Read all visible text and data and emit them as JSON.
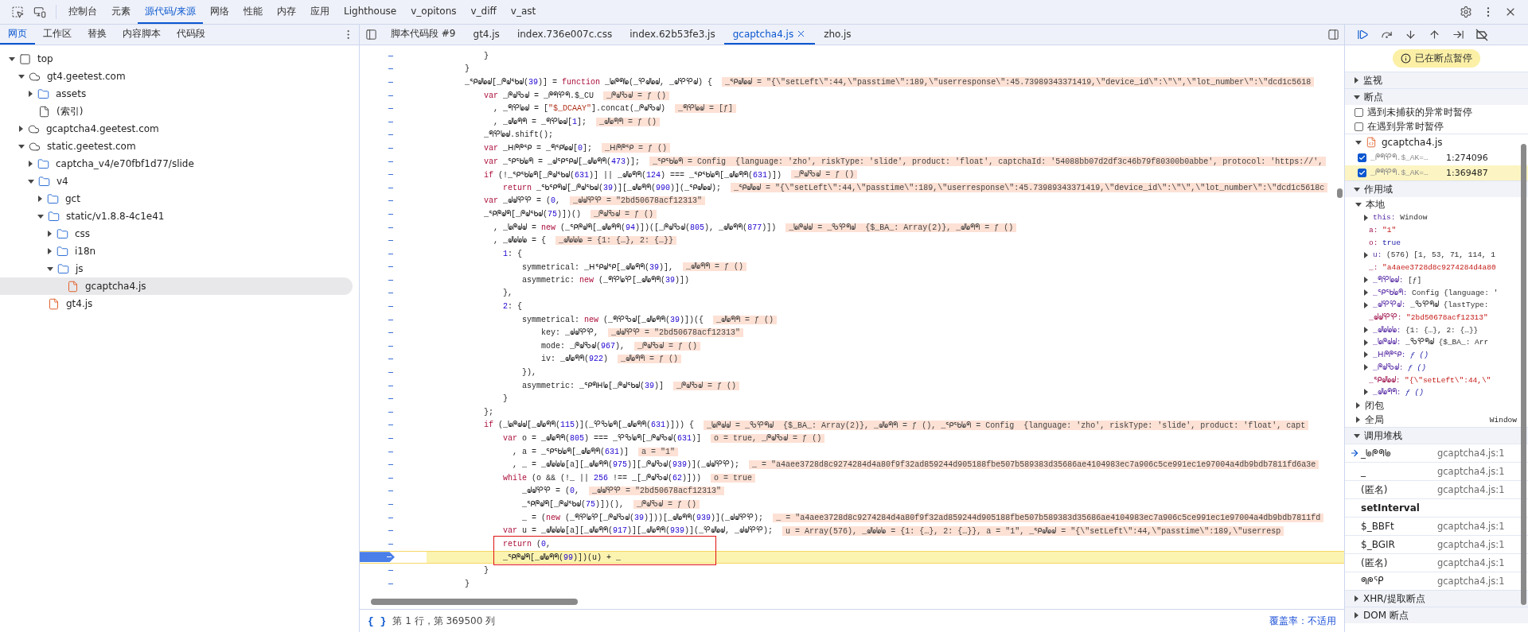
{
  "top_tabs": [
    {
      "label": "控制台",
      "selected": false
    },
    {
      "label": "元素",
      "selected": false
    },
    {
      "label": "源代码/来源",
      "selected": true
    },
    {
      "label": "网络",
      "selected": false
    },
    {
      "label": "性能",
      "selected": false
    },
    {
      "label": "内存",
      "selected": false
    },
    {
      "label": "应用",
      "selected": false
    },
    {
      "label": "Lighthouse",
      "selected": false
    },
    {
      "label": "v_opitons",
      "selected": false
    },
    {
      "label": "v_diff",
      "selected": false
    },
    {
      "label": "v_ast",
      "selected": false
    }
  ],
  "sidebar": {
    "tabs": [
      {
        "label": "网页",
        "selected": true
      },
      {
        "label": "工作区",
        "selected": false
      },
      {
        "label": "替换",
        "selected": false
      },
      {
        "label": "内容脚本",
        "selected": false
      },
      {
        "label": "代码段",
        "selected": false
      }
    ],
    "tree": [
      {
        "label": "top",
        "kind": "frame",
        "selected": false,
        "expanded": true,
        "children": [
          {
            "label": "gt4.geetest.com",
            "kind": "domain",
            "selected": false,
            "expanded": true,
            "children": [
              {
                "label": "assets",
                "kind": "folder",
                "selected": false,
                "expanded": false
              },
              {
                "label": "(索引)",
                "kind": "file",
                "selected": false
              }
            ]
          },
          {
            "label": "gcaptcha4.geetest.com",
            "kind": "domain",
            "selected": false,
            "expanded": false
          },
          {
            "label": "static.geetest.com",
            "kind": "domain",
            "selected": false,
            "expanded": true,
            "children": [
              {
                "label": "captcha_v4/e70fbf1d77/slide",
                "kind": "folder",
                "selected": false,
                "expanded": false
              },
              {
                "label": "v4",
                "kind": "folder",
                "selected": false,
                "expanded": true,
                "children": [
                  {
                    "label": "gct",
                    "kind": "folder",
                    "selected": false,
                    "expanded": false
                  },
                  {
                    "label": "static/v1.8.8-4c1e41",
                    "kind": "folder",
                    "selected": false,
                    "expanded": true,
                    "children": [
                      {
                        "label": "css",
                        "kind": "folder",
                        "selected": false,
                        "expanded": false
                      },
                      {
                        "label": "i18n",
                        "kind": "folder",
                        "selected": false,
                        "expanded": false
                      },
                      {
                        "label": "js",
                        "kind": "folder",
                        "selected": false,
                        "expanded": true,
                        "children": [
                          {
                            "label": "gcaptcha4.js",
                            "kind": "script",
                            "selected": true
                          }
                        ]
                      }
                    ]
                  },
                  {
                    "label": "gt4.js",
                    "kind": "script",
                    "selected": false
                  }
                ]
              }
            ]
          }
        ]
      }
    ]
  },
  "editor": {
    "tabs": [
      {
        "label": "脚本代码段 #9",
        "selected": false,
        "closable": false
      },
      {
        "label": "gt4.js",
        "selected": false,
        "closable": false
      },
      {
        "label": "index.736e007c.css",
        "selected": false,
        "closable": false
      },
      {
        "label": "index.62b53fe3.js",
        "selected": false,
        "closable": false
      },
      {
        "label": "gcaptcha4.js",
        "selected": true,
        "closable": true
      },
      {
        "label": "zho.js",
        "selected": false,
        "closable": false
      }
    ],
    "code_lines": [
      {
        "code": [
          {
            "kind": "plain",
            "text": "            }"
          }
        ],
        "paused": false,
        "boxed": false
      },
      {
        "code": [
          {
            "kind": "plain",
            "text": "        }"
          }
        ],
        "paused": false,
        "boxed": false
      },
      {
        "code": [
          {
            "kind": "plain",
            "text": "        _ᕿᖙᖚᖙ[_ᖘᖙᖃᖙ("
          },
          {
            "kind": "number",
            "text": "39"
          },
          {
            "kind": "plain",
            "text": ")] = "
          },
          {
            "kind": "keyword",
            "text": "function"
          },
          {
            "kind": "plain",
            "text": " _ᖚᖘᖗᖚ(_ᕿᖙᖚᖙ, _ᖙᕿᕿᖙ) {"
          }
        ],
        "value": "_ᕿᖙᖚᖙ = \"{\\\"setLeft\\\":44,\\\"passtime\\\":189,\\\"userresponse\\\":45.73989343371419,\\\"device_id\\\":\\\"\\\",\\\"lot_number\\\":\\\"dcd1c5618",
        "paused": false,
        "boxed": false
      },
      {
        "code": [
          {
            "kind": "keyword",
            "text": "            var"
          },
          {
            "kind": "plain",
            "text": " _ᖘᖙᖃᖙ = _ᖘᖗᕿᖗ.$_CU"
          }
        ],
        "value": "_ᖘᖙᖃᖙ = ƒ ()",
        "paused": false,
        "boxed": false
      },
      {
        "code": [
          {
            "kind": "plain",
            "text": "              , _ᖗᕿᖚᖙ = ["
          },
          {
            "kind": "string",
            "text": "\"$_DCAAY\""
          },
          {
            "kind": "plain",
            "text": "].concat(_ᖘᖙᖃᖙ)"
          }
        ],
        "value": "_ᖗᕿᖚᖙ = [ƒ]",
        "paused": false,
        "boxed": false
      },
      {
        "code": [
          {
            "kind": "plain",
            "text": "              , _ᖙᖚᖗᖗ = _ᖗᕿᖚᖙ["
          },
          {
            "kind": "number",
            "text": "1"
          },
          {
            "kind": "plain",
            "text": "];"
          }
        ],
        "value": "_ᖙᖚᖗᖗ = ƒ ()",
        "paused": false,
        "boxed": false
      },
      {
        "code": [
          {
            "kind": "plain",
            "text": "            _ᖗᕿᖚᖙ.shift();"
          }
        ],
        "paused": false,
        "boxed": false
      },
      {
        "code": [
          {
            "kind": "keyword",
            "text": "            var"
          },
          {
            "kind": "plain",
            "text": " _ᕼᖘᖘᕿ = _ᖗᕿᖚᖙ["
          },
          {
            "kind": "number",
            "text": "0"
          },
          {
            "kind": "plain",
            "text": "];"
          }
        ],
        "value": "_ᕼᖘᖘᕿ = ƒ ()",
        "paused": false,
        "boxed": false
      },
      {
        "code": [
          {
            "kind": "keyword",
            "text": "            var"
          },
          {
            "kind": "plain",
            "text": " _ᕿᖃᖚᖗ = _ᖙᕿᕿᖙ[_ᖙᖚᖗᖗ("
          },
          {
            "kind": "number",
            "text": "473"
          },
          {
            "kind": "plain",
            "text": ")];"
          }
        ],
        "value": "_ᕿᖃᖚᖗ = Config  {language: 'zho', riskType: 'slide', product: 'float', captchaId: '54088bb07d2df3c46b79f80300b0abbe', protocol: 'https://',",
        "paused": false,
        "boxed": false
      },
      {
        "code": [
          {
            "kind": "keyword",
            "text": "            if"
          },
          {
            "kind": "plain",
            "text": " (!_ᕿᖃᖚᖗ[_ᖘᖙᖃᖙ("
          },
          {
            "kind": "number",
            "text": "631"
          },
          {
            "kind": "plain",
            "text": ")] || _ᖙᖚᖗᖗ("
          },
          {
            "kind": "number",
            "text": "124"
          },
          {
            "kind": "plain",
            "text": ") === _ᕿᖃᖚᖗ[_ᖙᖚᖗᖗ("
          },
          {
            "kind": "number",
            "text": "631"
          },
          {
            "kind": "plain",
            "text": ")])"
          }
        ],
        "value": "_ᖘᖙᖃᖙ = ƒ ()",
        "paused": false,
        "boxed": false
      },
      {
        "code": [
          {
            "kind": "keyword",
            "text": "                return"
          },
          {
            "kind": "plain",
            "text": " _ᖃᕿᖗᖙ[_ᖘᖙᖃᖙ("
          },
          {
            "kind": "number",
            "text": "39"
          },
          {
            "kind": "plain",
            "text": ")][_ᖙᖚᖗᖗ("
          },
          {
            "kind": "number",
            "text": "990"
          },
          {
            "kind": "plain",
            "text": ")](_ᕿᖙᖚᖙ);"
          }
        ],
        "value": "_ᕿᖙᖚᖙ = \"{\\\"setLeft\\\":44,\\\"passtime\\\":189,\\\"userresponse\\\":45.73989343371419,\\\"device_id\\\":\\\"\\\",\\\"lot_number\\\":\\\"dcd1c5618c",
        "paused": false,
        "boxed": false
      },
      {
        "code": [
          {
            "kind": "keyword",
            "text": "            var"
          },
          {
            "kind": "plain",
            "text": " _ᖙᖙᕿᕿ = ("
          },
          {
            "kind": "number",
            "text": "0"
          },
          {
            "kind": "plain",
            "text": ","
          }
        ],
        "value": "_ᖙᖙᕿᕿ = \"2bd50678acf12313\"",
        "paused": false,
        "boxed": false
      },
      {
        "code": [
          {
            "kind": "plain",
            "text": "            _ᕿᖘᖙᖗ[_ᖘᖙᖃᖙ("
          },
          {
            "kind": "number",
            "text": "75"
          },
          {
            "kind": "plain",
            "text": ")])()"
          }
        ],
        "value": "_ᖘᖙᖃᖙ = ƒ ()",
        "paused": false,
        "boxed": false
      },
      {
        "code": [
          {
            "kind": "plain",
            "text": "              , _ᖚᖘᖙᖙ = "
          },
          {
            "kind": "keyword",
            "text": "new"
          },
          {
            "kind": "plain",
            "text": " (_ᕿᖘᖙᖗ[_ᖙᖚᖗᖗ("
          },
          {
            "kind": "number",
            "text": "94"
          },
          {
            "kind": "plain",
            "text": ")])([_ᖘᖙᖃᖙ("
          },
          {
            "kind": "number",
            "text": "805"
          },
          {
            "kind": "plain",
            "text": "), _ᖙᖚᖗᖗ("
          },
          {
            "kind": "number",
            "text": "877"
          },
          {
            "kind": "plain",
            "text": ")])"
          }
        ],
        "value": "_ᖚᖘᖙᖙ = _ᖃᕿᖗᖙ  {$_BA_: Array(2)}, _ᖙᖚᖗᖗ = ƒ ()",
        "paused": false,
        "boxed": false
      },
      {
        "code": [
          {
            "kind": "plain",
            "text": "              , _ᖙᖚᖚᖚ = {"
          }
        ],
        "value": "_ᖙᖚᖚᖚ = {1: {…}, 2: {…}}",
        "paused": false,
        "boxed": false
      },
      {
        "code": [
          {
            "kind": "number",
            "text": "                1"
          },
          {
            "kind": "plain",
            "text": ": {"
          }
        ],
        "paused": false,
        "boxed": false
      },
      {
        "code": [
          {
            "kind": "plain",
            "text": "                    symmetrical: _ᕼᕿᖙᕿ[_ᖙᖚᖗᖗ("
          },
          {
            "kind": "number",
            "text": "39"
          },
          {
            "kind": "plain",
            "text": ")],"
          }
        ],
        "value": "_ᖙᖚᖗᖗ = ƒ ()",
        "paused": false,
        "boxed": false
      },
      {
        "code": [
          {
            "kind": "plain",
            "text": "                    asymmetric: "
          },
          {
            "kind": "keyword",
            "text": "new"
          },
          {
            "kind": "plain",
            "text": " (_ᖗᕿᖚᕿ[_ᖙᖚᖗᖗ("
          },
          {
            "kind": "number",
            "text": "39"
          },
          {
            "kind": "plain",
            "text": ")])"
          }
        ],
        "paused": false,
        "boxed": false
      },
      {
        "code": [
          {
            "kind": "plain",
            "text": "                },"
          }
        ],
        "paused": false,
        "boxed": false
      },
      {
        "code": [
          {
            "kind": "number",
            "text": "                2"
          },
          {
            "kind": "plain",
            "text": ": {"
          }
        ],
        "paused": false,
        "boxed": false
      },
      {
        "code": [
          {
            "kind": "plain",
            "text": "                    symmetrical: "
          },
          {
            "kind": "keyword",
            "text": "new"
          },
          {
            "kind": "plain",
            "text": " (_ᖗᕿᖃᖙ[_ᖙᖚᖗᖗ("
          },
          {
            "kind": "number",
            "text": "39"
          },
          {
            "kind": "plain",
            "text": ")])({"
          }
        ],
        "value": "_ᖙᖚᖗᖗ = ƒ ()",
        "paused": false,
        "boxed": false
      },
      {
        "code": [
          {
            "kind": "plain",
            "text": "                        key: _ᖙᖙᕿᕿ,"
          }
        ],
        "value": "_ᖙᖙᕿᕿ = \"2bd50678acf12313\"",
        "paused": false,
        "boxed": false
      },
      {
        "code": [
          {
            "kind": "plain",
            "text": "                        mode: _ᖘᖙᖃᖙ("
          },
          {
            "kind": "number",
            "text": "967"
          },
          {
            "kind": "plain",
            "text": "),"
          }
        ],
        "value": "_ᖘᖙᖃᖙ = ƒ ()",
        "paused": false,
        "boxed": false
      },
      {
        "code": [
          {
            "kind": "plain",
            "text": "                        iv: _ᖙᖚᖗᖗ("
          },
          {
            "kind": "number",
            "text": "922"
          },
          {
            "kind": "plain",
            "text": ")"
          }
        ],
        "value": "_ᖙᖚᖗᖗ = ƒ ()",
        "paused": false,
        "boxed": false
      },
      {
        "code": [
          {
            "kind": "plain",
            "text": "                    }),"
          }
        ],
        "paused": false,
        "boxed": false
      },
      {
        "code": [
          {
            "kind": "plain",
            "text": "                    asymmetric: _ᕿᖗᕼᖚ[_ᖘᖙᖃᖙ("
          },
          {
            "kind": "number",
            "text": "39"
          },
          {
            "kind": "plain",
            "text": ")]"
          }
        ],
        "value": "_ᖘᖙᖃᖙ = ƒ ()",
        "paused": false,
        "boxed": false
      },
      {
        "code": [
          {
            "kind": "plain",
            "text": "                }"
          }
        ],
        "paused": false,
        "boxed": false
      },
      {
        "code": [
          {
            "kind": "plain",
            "text": "            };"
          }
        ],
        "paused": false,
        "boxed": false
      },
      {
        "code": [
          {
            "kind": "keyword",
            "text": "            if"
          },
          {
            "kind": "plain",
            "text": " (_ᖚᖘᖙᖙ[_ᖙᖚᖗᖗ("
          },
          {
            "kind": "number",
            "text": "115"
          },
          {
            "kind": "plain",
            "text": ")](_ᕿᖃᖚᖗ[_ᖙᖚᖗᖗ("
          },
          {
            "kind": "number",
            "text": "631"
          },
          {
            "kind": "plain",
            "text": ")])) {"
          }
        ],
        "value": "_ᖚᖘᖙᖙ = _ᖃᕿᖗᖙ  {$_BA_: Array(2)}, _ᖙᖚᖗᖗ = ƒ (), _ᕿᖃᖚᖗ = Config  {language: 'zho', riskType: 'slide', product: 'float', capt",
        "paused": false,
        "boxed": false
      },
      {
        "code": [
          {
            "kind": "keyword",
            "text": "                var"
          },
          {
            "kind": "plain",
            "text": " o = _ᖙᖚᖗᖗ("
          },
          {
            "kind": "number",
            "text": "805"
          },
          {
            "kind": "plain",
            "text": ") === _ᕿᖃᖚᖗ[_ᖘᖙᖃᖙ("
          },
          {
            "kind": "number",
            "text": "631"
          },
          {
            "kind": "plain",
            "text": ")]"
          }
        ],
        "value": "o = true, _ᖘᖙᖃᖙ = ƒ ()",
        "paused": false,
        "boxed": false
      },
      {
        "code": [
          {
            "kind": "plain",
            "text": "                  , a = _ᕿᖃᖚᖗ[_ᖙᖚᖗᖗ("
          },
          {
            "kind": "number",
            "text": "631"
          },
          {
            "kind": "plain",
            "text": ")]"
          }
        ],
        "value": "a = \"1\"",
        "paused": false,
        "boxed": false
      },
      {
        "code": [
          {
            "kind": "plain",
            "text": "                  , _ = _ᖙᖚᖚᖚ[a][_ᖙᖚᖗᖗ("
          },
          {
            "kind": "number",
            "text": "975"
          },
          {
            "kind": "plain",
            "text": ")][_ᖘᖙᖃᖙ("
          },
          {
            "kind": "number",
            "text": "939"
          },
          {
            "kind": "plain",
            "text": ")](_ᖙᖙᕿᕿ);"
          }
        ],
        "value": "_ = \"a4aee3728d8c9274284d4a80f9f32ad859244d905188fbe507b589383d35686ae4104983ec7a906c5ce991ec1e97004a4db9bdb7811fd6a3e",
        "paused": false,
        "boxed": false
      },
      {
        "code": [
          {
            "kind": "keyword",
            "text": "                while"
          },
          {
            "kind": "plain",
            "text": " (o && (!_ || "
          },
          {
            "kind": "number",
            "text": "256"
          },
          {
            "kind": "plain",
            "text": " !== _[_ᖘᖙᖃᖙ("
          },
          {
            "kind": "number",
            "text": "62"
          },
          {
            "kind": "plain",
            "text": ")]))"
          }
        ],
        "value": "o = true",
        "paused": false,
        "boxed": false
      },
      {
        "code": [
          {
            "kind": "plain",
            "text": "                    _ᖙᖙᕿᕿ = ("
          },
          {
            "kind": "number",
            "text": "0"
          },
          {
            "kind": "plain",
            "text": ","
          }
        ],
        "value": "_ᖙᖙᕿᕿ = \"2bd50678acf12313\"",
        "paused": false,
        "boxed": false
      },
      {
        "code": [
          {
            "kind": "plain",
            "text": "                    _ᕿᖘᖙᖗ[_ᖘᖙᖃᖙ("
          },
          {
            "kind": "number",
            "text": "75"
          },
          {
            "kind": "plain",
            "text": ")])(),"
          }
        ],
        "value": "_ᖘᖙᖃᖙ = ƒ ()",
        "paused": false,
        "boxed": false
      },
      {
        "code": [
          {
            "kind": "plain",
            "text": "                    _ = ("
          },
          {
            "kind": "keyword",
            "text": "new"
          },
          {
            "kind": "plain",
            "text": " (_ᖗᕿᖚᕿ[_ᖘᖙᖃᖙ("
          },
          {
            "kind": "number",
            "text": "39"
          },
          {
            "kind": "plain",
            "text": ")]))[_ᖙᖚᖗᖗ("
          },
          {
            "kind": "number",
            "text": "939"
          },
          {
            "kind": "plain",
            "text": ")](_ᖙᖙᕿᕿ);"
          }
        ],
        "value": "_ = \"a4aee3728d8c9274284d4a80f9f32ad859244d905188fbe507b589383d35686ae4104983ec7a906c5ce991ec1e97004a4db9bdb7811fd",
        "paused": false,
        "boxed": false
      },
      {
        "code": [
          {
            "kind": "keyword",
            "text": "                var"
          },
          {
            "kind": "plain",
            "text": " u = _ᖙᖚᖚᖚ[a][_ᖙᖚᖗᖗ("
          },
          {
            "kind": "number",
            "text": "917"
          },
          {
            "kind": "plain",
            "text": ")][_ᖙᖚᖗᖗ("
          },
          {
            "kind": "number",
            "text": "939"
          },
          {
            "kind": "plain",
            "text": ")](_ᕿᖙᖚᖙ, _ᖙᖙᕿᕿ);"
          }
        ],
        "value": "u = Array(576), _ᖙᖚᖚᖚ = {1: {…}, 2: {…}}, a = \"1\", _ᕿᖙᖚᖙ = \"{\\\"setLeft\\\":44,\\\"passtime\\\":189,\\\"userresp",
        "paused": false,
        "boxed": false
      },
      {
        "code": [
          {
            "kind": "keyword",
            "text": "                return"
          },
          {
            "kind": "plain",
            "text": " ("
          },
          {
            "kind": "number",
            "text": "0"
          },
          {
            "kind": "plain",
            "text": ","
          }
        ],
        "paused": false,
        "boxed": true
      },
      {
        "code": [
          {
            "kind": "plain",
            "text": "                _ᕿᖘᖙᖗ[_ᖙᖚᖗᖗ("
          },
          {
            "kind": "number",
            "text": "99"
          },
          {
            "kind": "plain",
            "text": ")])(u) + _"
          }
        ],
        "paused": true,
        "boxed": true
      },
      {
        "code": [
          {
            "kind": "plain",
            "text": "            }"
          }
        ],
        "paused": false,
        "boxed": false
      },
      {
        "code": [
          {
            "kind": "plain",
            "text": "        }"
          }
        ],
        "paused": false,
        "boxed": false
      }
    ],
    "status": {
      "braces": "{ }",
      "position": "第 1 行，第 369500 列",
      "coverage": "覆盖率：不适用"
    }
  },
  "debugger": {
    "paused_badge": "已在断点暂停",
    "watch": {
      "title": "监视",
      "expanded": false
    },
    "breakpoints": {
      "title": "断点",
      "expanded": true,
      "options": [
        {
          "label": "遇到未捕获的异常时暂停",
          "checked": false
        },
        {
          "label": "在遇到异常时暂停",
          "checked": false
        }
      ],
      "file": {
        "label": "gcaptcha4.js",
        "expanded": true
      },
      "items": [
        {
          "label": "_ᖘᖗᕿᖗ.$_AK=…",
          "location": "1:274096",
          "checked": true,
          "selected": false
        },
        {
          "label": "_ᖘᖗᕿᖗ.$_AK=…",
          "location": "1:369487",
          "checked": true,
          "selected": true
        }
      ]
    },
    "scope": {
      "title": "作用域",
      "expanded": true,
      "groups": [
        {
          "label": "本地",
          "expanded": true,
          "items": [
            {
              "name": "this:",
              "value": "Window",
              "expandable": true,
              "kind": "object"
            },
            {
              "name": "a:",
              "value": "\"1\"",
              "expandable": false,
              "kind": "string"
            },
            {
              "name": "o:",
              "value": "true",
              "expandable": false,
              "kind": "literal"
            },
            {
              "name": "u:",
              "value": "(576)  [1, 53, 71, 114, 1",
              "expandable": true,
              "kind": "object"
            },
            {
              "name": "_:",
              "value": "\"a4aee3728d8c9274284d4a80",
              "expandable": false,
              "kind": "string"
            },
            {
              "name": "_ᖗᕿᖚᖙ:",
              "value": "[ƒ]",
              "expandable": true,
              "kind": "object"
            },
            {
              "name": "_ᕿᖃᖚᖗ:",
              "value": "Config  {language: '",
              "expandable": true,
              "kind": "object"
            },
            {
              "name": "_ᖙᕿᕿᖙ:",
              "value": "_ᖃᕿᖗᖙ  {lastType:",
              "expandable": true,
              "kind": "object"
            },
            {
              "name": "_ᖙᖙᕿᕿ:",
              "value": "\"2bd50678acf12313\"",
              "expandable": false,
              "kind": "string"
            },
            {
              "name": "_ᖙᖚᖚᖚ:",
              "value": "{1: {…}, 2: {…}}",
              "expandable": true,
              "kind": "object"
            },
            {
              "name": "_ᖚᖘᖙᖙ:",
              "value": "_ᖃᕿᖗᖙ  {$_BA_: Arr",
              "expandable": true,
              "kind": "object"
            },
            {
              "name": "_ᕼᖘᖘᕿ:",
              "value": "ƒ ()",
              "expandable": true,
              "kind": "function"
            },
            {
              "name": "_ᖘᖙᖃᖙ:",
              "value": "ƒ ()",
              "expandable": true,
              "kind": "function"
            },
            {
              "name": "_ᕿᖙᖚᖙ:",
              "value": "\"{\\\"setLeft\\\":44,\\\"",
              "expandable": false,
              "kind": "string"
            },
            {
              "name": "_ᖙᖚᖗᖗ:",
              "value": "ƒ ()",
              "expandable": true,
              "kind": "function"
            }
          ]
        },
        {
          "label": "闭包",
          "expanded": false
        },
        {
          "label": "全局",
          "expanded": false,
          "value": "Window"
        }
      ]
    },
    "call_stack": {
      "title": "调用堆栈",
      "expanded": true,
      "frames": [
        {
          "kind": "frame",
          "name": "_ᖚᖘᖗᖚ",
          "location": "gcaptcha4.js:1",
          "current": true
        },
        {
          "kind": "frame",
          "name": "_",
          "location": "gcaptcha4.js:1",
          "current": false
        },
        {
          "kind": "frame",
          "name": "(匿名)",
          "location": "gcaptcha4.js:1",
          "current": false
        },
        {
          "kind": "async",
          "name": "setInterval"
        },
        {
          "kind": "frame",
          "name": "$_BBFt",
          "location": "gcaptcha4.js:1",
          "current": false
        },
        {
          "kind": "frame",
          "name": "$_BGIR",
          "location": "gcaptcha4.js:1",
          "current": false
        },
        {
          "kind": "frame",
          "name": "(匿名)",
          "location": "gcaptcha4.js:1",
          "current": false
        },
        {
          "kind": "frame",
          "name": "ᖗᖘᕿ",
          "location": "gcaptcha4.js:1",
          "current": false
        }
      ]
    },
    "more_sections": [
      {
        "title": "XHR/提取断点",
        "expanded": false
      },
      {
        "title": "DOM 断点",
        "expanded": false
      }
    ]
  }
}
